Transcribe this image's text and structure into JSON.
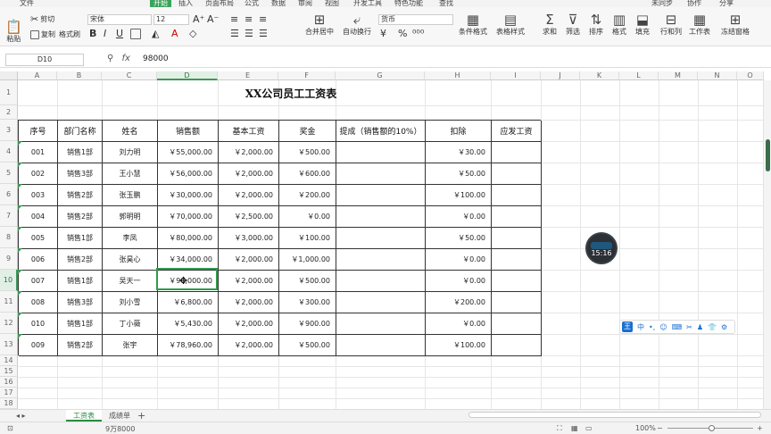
{
  "menu": {
    "items": [
      "文件",
      "开始",
      "插入",
      "页面布局",
      "公式",
      "数据",
      "审阅",
      "视图",
      "开发工具",
      "特色功能",
      "查找"
    ],
    "right": [
      "未同步",
      "协作",
      "分享"
    ]
  },
  "ribbon": {
    "paste": "粘贴",
    "cut": "剪切",
    "copy": "复制",
    "format_painter": "格式刷",
    "font_name": "宋体",
    "font_size": "12",
    "merge_center": "合并居中",
    "wrap_text": "自动换行",
    "number_format": "货币",
    "conditional_format": "条件格式",
    "table_style": "表格样式",
    "sum": "求和",
    "filter": "筛选",
    "sort": "排序",
    "format": "格式",
    "fill": "填充",
    "row_col": "行和列",
    "worksheet": "工作表",
    "freeze": "冻结窗格"
  },
  "formula_bar": {
    "cell_ref": "D10",
    "value": "98000"
  },
  "columns": [
    "A",
    "B",
    "C",
    "D",
    "E",
    "F",
    "G",
    "H",
    "I",
    "J",
    "K",
    "L",
    "M",
    "N",
    "O"
  ],
  "rows": [
    "1",
    "2",
    "3",
    "4",
    "5",
    "6",
    "7",
    "8",
    "9",
    "10",
    "11",
    "12",
    "13",
    "14",
    "15",
    "16",
    "17",
    "18"
  ],
  "sheet": {
    "title": "XX公司员工工资表",
    "headers": [
      "序号",
      "部门名称",
      "姓名",
      "销售额",
      "基本工资",
      "奖金",
      "提成（销售额的10%）",
      "扣除",
      "应发工资"
    ],
    "rows": [
      [
        "001",
        "销售1部",
        "刘力明",
        "￥55,000.00",
        "￥2,000.00",
        "￥500.00",
        "",
        "￥30.00",
        ""
      ],
      [
        "002",
        "销售3部",
        "王小慧",
        "￥56,000.00",
        "￥2,000.00",
        "￥600.00",
        "",
        "￥50.00",
        ""
      ],
      [
        "003",
        "销售2部",
        "张玉鹏",
        "￥30,000.00",
        "￥2,000.00",
        "￥200.00",
        "",
        "￥100.00",
        ""
      ],
      [
        "004",
        "销售2部",
        "郭明明",
        "￥70,000.00",
        "￥2,500.00",
        "￥0.00",
        "",
        "￥0.00",
        ""
      ],
      [
        "005",
        "销售1部",
        "李凤",
        "￥80,000.00",
        "￥3,000.00",
        "￥100.00",
        "",
        "￥50.00",
        ""
      ],
      [
        "006",
        "销售2部",
        "张昊心",
        "￥34,000.00",
        "￥2,000.00",
        "￥1,000.00",
        "",
        "￥0.00",
        ""
      ],
      [
        "007",
        "销售1部",
        "吴天一",
        "￥98,000.00",
        "￥2,000.00",
        "￥500.00",
        "",
        "￥0.00",
        ""
      ],
      [
        "008",
        "销售3部",
        "刘小雪",
        "￥6,800.00",
        "￥2,000.00",
        "￥300.00",
        "",
        "￥200.00",
        ""
      ],
      [
        "010",
        "销售1部",
        "丁小薇",
        "￥5,430.00",
        "￥2,000.00",
        "￥900.00",
        "",
        "￥0.00",
        ""
      ],
      [
        "009",
        "销售2部",
        "张宇",
        "￥78,960.00",
        "￥2,000.00",
        "￥500.00",
        "",
        "￥100.00",
        ""
      ]
    ]
  },
  "tabs": [
    "工资表",
    "成绩单"
  ],
  "timer": "15:16",
  "ime": {
    "logo": "王",
    "mode": "中"
  },
  "status": {
    "summary": "9万8000",
    "zoom": "100%"
  },
  "colors": {
    "accent": "#2f9a4c"
  }
}
